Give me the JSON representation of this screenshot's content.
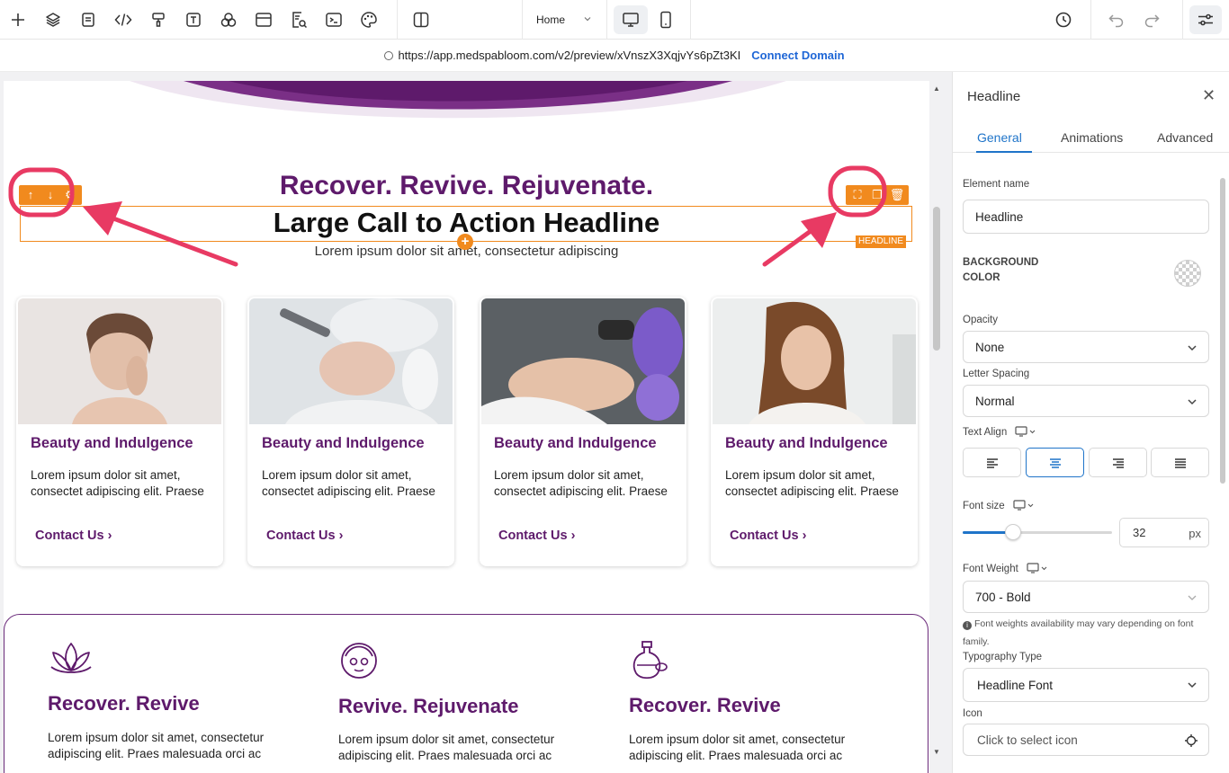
{
  "toolbar": {
    "tools": [
      "add-icon",
      "layers-icon",
      "pages-icon",
      "code-icon",
      "paint-roller-icon",
      "text-icon",
      "elements-icon",
      "sections-icon",
      "form-search-icon",
      "terminal-icon",
      "palette-icon",
      "split-view-icon"
    ],
    "page_select": "Home",
    "devices": [
      "desktop",
      "mobile"
    ],
    "active_device": "desktop"
  },
  "urlbar": {
    "url": "https://app.medspabloom.com/v2/preview/xVnszX3XqjvYs6pZt3KI",
    "connect_label": "Connect Domain"
  },
  "canvas": {
    "tagline": "Recover. Revive. Rejuvenate.",
    "headline": "Large Call to Action Headline",
    "subtext": "Lorem ipsum dolor sit amet, consectetur adipiscing",
    "headline_badge": "HEADLINE",
    "cards": [
      {
        "title": "Beauty and Indulgence",
        "body": "Lorem ipsum dolor sit amet, consectet adipiscing elit. Praese",
        "link": "Contact Us ›"
      },
      {
        "title": "Beauty and Indulgence",
        "body": "Lorem ipsum dolor sit amet, consectet adipiscing elit. Praese",
        "link": "Contact Us ›"
      },
      {
        "title": "Beauty and Indulgence",
        "body": "Lorem ipsum dolor sit amet, consectet adipiscing elit. Praese",
        "link": "Contact Us ›"
      },
      {
        "title": "Beauty and Indulgence",
        "body": "Lorem ipsum dolor sit amet, consectet adipiscing elit. Praese",
        "link": "Contact Us ›"
      }
    ],
    "features": [
      {
        "icon": "lotus-icon",
        "title": "Recover. Revive",
        "body": "Lorem ipsum dolor sit amet, consectetur adipiscing elit. Praes malesuada orci ac"
      },
      {
        "icon": "face-mask-icon",
        "title": "Revive. Rejuvenate",
        "body": "Lorem ipsum dolor sit amet, consectetur adipiscing elit. Praes malesuada orci ac"
      },
      {
        "icon": "oil-bottle-icon",
        "title": "Recover. Revive",
        "body": "Lorem ipsum dolor sit amet, consectetur adipiscing elit. Praes malesuada orci ac"
      }
    ]
  },
  "panel": {
    "title": "Headline",
    "tabs": [
      "General",
      "Animations",
      "Advanced"
    ],
    "active_tab": "General",
    "element_name_label": "Element name",
    "element_name_value": "Headline",
    "bg_color_label_1": "BACKGROUND",
    "bg_color_label_2": "COLOR",
    "opacity_label": "Opacity",
    "opacity_value": "None",
    "letter_spacing_label": "Letter Spacing",
    "letter_spacing_value": "Normal",
    "text_align_label": "Text Align",
    "text_align_active": "center",
    "font_size_label": "Font size",
    "font_size_value": "32",
    "font_size_unit": "px",
    "font_size_slider_fraction": 0.34,
    "font_weight_label": "Font Weight",
    "font_weight_value": "700 - Bold",
    "font_weight_note": "Font weights availability may vary depending on font family.",
    "typography_label": "Typography Type",
    "typography_value": "Headline Font",
    "icon_label": "Icon",
    "icon_placeholder": "Click to select icon"
  },
  "colors": {
    "brand_purple": "#5e1a6b",
    "selection_orange": "#f18a1e",
    "accent_blue": "#1f74c9",
    "annotation_pink": "#e83a63"
  }
}
